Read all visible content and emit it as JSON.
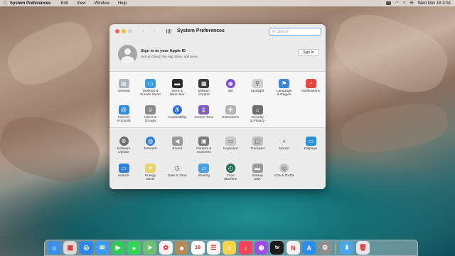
{
  "menubar": {
    "app_name": "System Preferences",
    "items": [
      "Edit",
      "View",
      "Window",
      "Help"
    ],
    "clock": "Wed Nov 18  4:04"
  },
  "window": {
    "title": "System Preferences",
    "search_placeholder": "Search"
  },
  "apple_id": {
    "title": "Sign in to your Apple ID",
    "subtitle": "Set up iCloud, the App Store, and more.",
    "button": "Sign In"
  },
  "section1": [
    {
      "label": "General",
      "icon": "general-icon",
      "color": "#b0b4bb"
    },
    {
      "label": "Desktop &\nScreen Saver",
      "icon": "desktop-icon",
      "color": "#3a9be0"
    },
    {
      "label": "Dock &\nMenu Bar",
      "icon": "dock-icon",
      "color": "#2a2a2a"
    },
    {
      "label": "Mission\nControl",
      "icon": "mission-control-icon",
      "color": "#3a3a3a"
    },
    {
      "label": "Siri",
      "icon": "siri-icon",
      "color": "#7b4fd9"
    },
    {
      "label": "Spotlight",
      "icon": "spotlight-icon",
      "color": "#d0d0d0"
    },
    {
      "label": "Language\n& Region",
      "icon": "language-icon",
      "color": "#3b86d6"
    },
    {
      "label": "Notifications",
      "icon": "notifications-icon",
      "color": "#e8453c"
    },
    {
      "label": "Internet\nAccounts",
      "icon": "at-icon",
      "color": "#2f8ae6"
    },
    {
      "label": "Users &\nGroups",
      "icon": "users-icon",
      "color": "#8b8b8b"
    },
    {
      "label": "Accessibility",
      "icon": "accessibility-icon",
      "color": "#2f7be0"
    },
    {
      "label": "Screen Time",
      "icon": "hourglass-icon",
      "color": "#7c5bd0"
    },
    {
      "label": "Extensions",
      "icon": "puzzle-icon",
      "color": "#b5b5b5"
    },
    {
      "label": "Security\n& Privacy",
      "icon": "house-icon",
      "color": "#6d6d6d"
    }
  ],
  "section2": [
    {
      "label": "Software\nUpdate",
      "icon": "gear-icon",
      "color": "#6c6c6c"
    },
    {
      "label": "Network",
      "icon": "globe-icon",
      "color": "#2e7ed8"
    },
    {
      "label": "Sound",
      "icon": "speaker-icon",
      "color": "#9a9a9a"
    },
    {
      "label": "Printers &\nScanners",
      "icon": "printer-icon",
      "color": "#7a7a7a"
    },
    {
      "label": "Keyboard",
      "icon": "keyboard-icon",
      "color": "#c9c9c9"
    },
    {
      "label": "Trackpad",
      "icon": "trackpad-icon",
      "color": "#bdbdbd"
    },
    {
      "label": "Mouse",
      "icon": "mouse-icon",
      "color": "#e9e9e9"
    },
    {
      "label": "Displays",
      "icon": "display-icon",
      "color": "#2a8fd8"
    },
    {
      "label": "Sidecar",
      "icon": "sidecar-icon",
      "color": "#2f7fd6"
    },
    {
      "label": "Energy\nSaver",
      "icon": "bulb-icon",
      "color": "#e9d36a"
    },
    {
      "label": "Date & Time",
      "icon": "clock-icon",
      "color": "#e7e7e7"
    },
    {
      "label": "Sharing",
      "icon": "folder-icon",
      "color": "#4aa3e0"
    },
    {
      "label": "Time\nMachine",
      "icon": "time-machine-icon",
      "color": "#1f6f5a"
    },
    {
      "label": "Startup\nDisk",
      "icon": "disk-icon",
      "color": "#9a9a9a"
    },
    {
      "label": "CDs & DVDs",
      "icon": "cd-icon",
      "color": "#c6c6c6"
    }
  ],
  "dock": [
    {
      "name": "finder-icon",
      "color": "#3c8fe8",
      "glyph": "☺"
    },
    {
      "name": "launchpad-icon",
      "color": "#d9d9d9",
      "glyph": "▦"
    },
    {
      "name": "safari-icon",
      "color": "#2d87e6",
      "glyph": "◎"
    },
    {
      "name": "mail-icon",
      "color": "#3a9af0",
      "glyph": "✉"
    },
    {
      "name": "facetime-icon",
      "color": "#34c759",
      "glyph": "▶"
    },
    {
      "name": "messages-icon",
      "color": "#3ad35a",
      "glyph": "●"
    },
    {
      "name": "maps-icon",
      "color": "#6ac16e",
      "glyph": "➤"
    },
    {
      "name": "photos-icon",
      "color": "#f2f2f2",
      "glyph": "✿"
    },
    {
      "name": "contacts-icon",
      "color": "#b38a5a",
      "glyph": "☻"
    },
    {
      "name": "calendar-icon",
      "color": "#ffffff",
      "glyph": "18"
    },
    {
      "name": "reminders-icon",
      "color": "#f4f4f4",
      "glyph": "☰"
    },
    {
      "name": "notes-icon",
      "color": "#f7d54a",
      "glyph": "≡"
    },
    {
      "name": "music-icon",
      "color": "#f5435b",
      "glyph": "♪"
    },
    {
      "name": "podcasts-icon",
      "color": "#9b4fe0",
      "glyph": "◉"
    },
    {
      "name": "tv-icon",
      "color": "#1c1c1c",
      "glyph": "tv"
    },
    {
      "name": "news-icon",
      "color": "#f1f1f1",
      "glyph": "N"
    },
    {
      "name": "app-store-icon",
      "color": "#2b8cef",
      "glyph": "A"
    },
    {
      "name": "system-preferences-icon",
      "color": "#8e8e8e",
      "glyph": "⚙"
    },
    {
      "name": "downloads-folder-icon",
      "color": "#4aa5ea",
      "glyph": "⬇"
    },
    {
      "name": "trash-icon",
      "color": "#e6e6e6",
      "glyph": "🗑"
    }
  ]
}
